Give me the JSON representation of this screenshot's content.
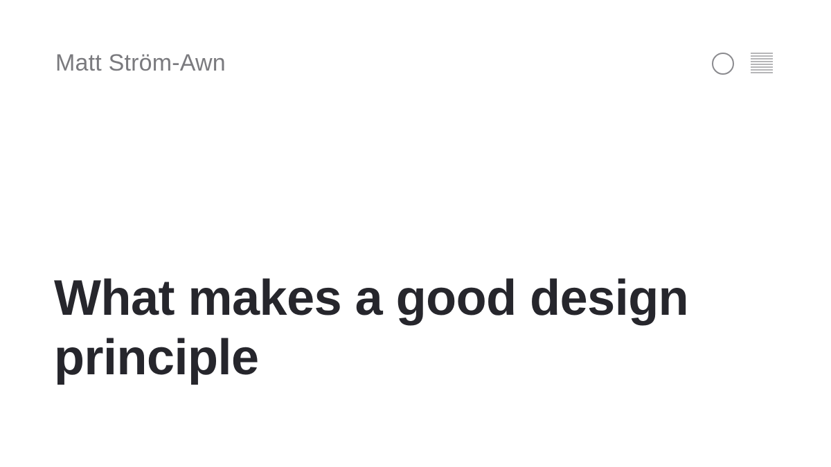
{
  "header": {
    "site_name": "Matt Ström-Awn",
    "theme_toggle_icon": "circle-icon",
    "menu_icon": "lines-menu-icon"
  },
  "article": {
    "title": "What makes a good design principle"
  },
  "colors": {
    "site_name": "#7a7a7e",
    "title": "#26262c",
    "icon": "#8a8a8e",
    "background": "#ffffff"
  }
}
